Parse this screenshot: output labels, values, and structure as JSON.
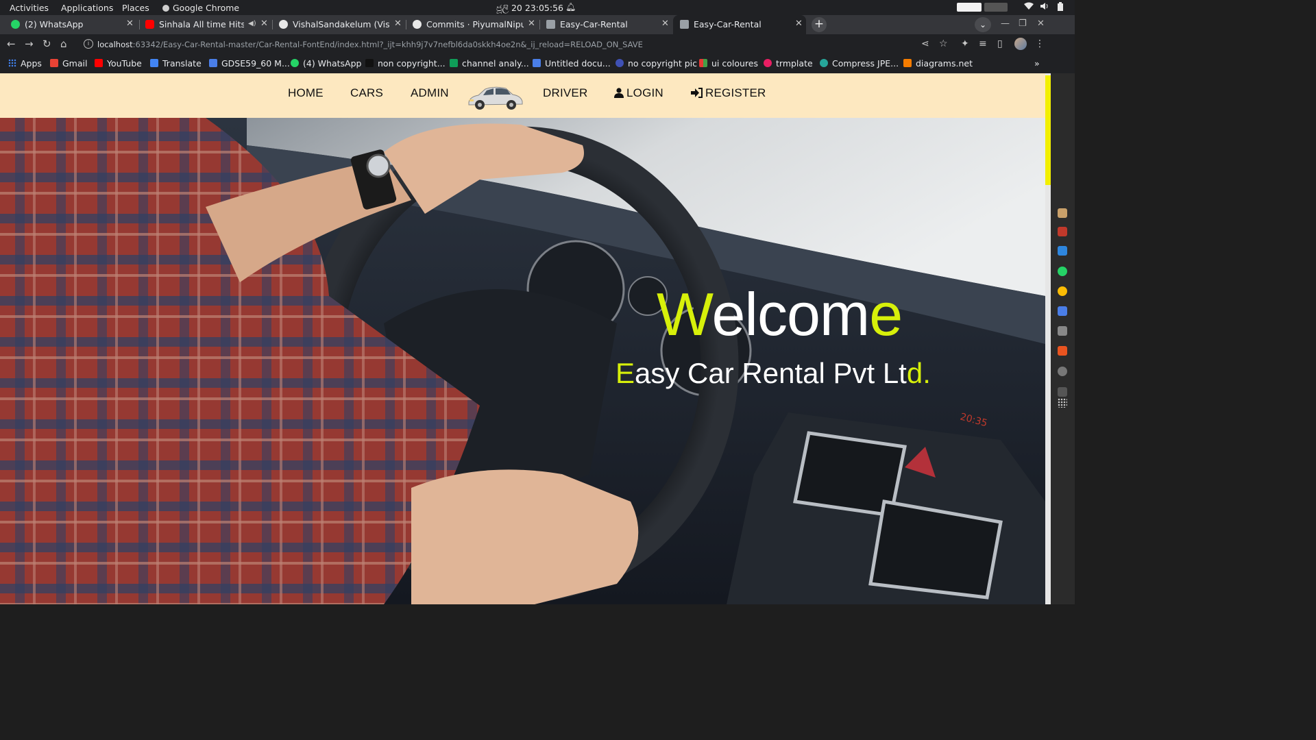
{
  "os_bar": {
    "activities": "Activities",
    "applications": "Applications",
    "places": "Places",
    "active_app": "Google Chrome",
    "datetime": "ජූලි 20  23:05:56"
  },
  "tabs": [
    {
      "title": "(2) WhatsApp",
      "active": false
    },
    {
      "title": "Sinhala All time Hits M",
      "active": false
    },
    {
      "title": "VishalSandakelum (Vishal",
      "active": false
    },
    {
      "title": "Commits · PiyumalNipuna",
      "active": false
    },
    {
      "title": "Easy-Car-Rental",
      "active": false
    },
    {
      "title": "Easy-Car-Rental",
      "active": true
    }
  ],
  "address_bar": {
    "host": "localhost",
    "path": ":63342/Easy-Car-Rental-master/Car-Rental-FontEnd/index.html?_ijt=khh9j7v7nefbl6da0skkh4oe2n&_ij_reload=RELOAD_ON_SAVE"
  },
  "bookmarks": [
    {
      "label": "Apps",
      "color": "#4285f4"
    },
    {
      "label": "Gmail",
      "color": "#ea4335"
    },
    {
      "label": "YouTube",
      "color": "#ff0000"
    },
    {
      "label": "Translate",
      "color": "#4285f4"
    },
    {
      "label": "GDSE59_60 M...",
      "color": "#4a7ee8"
    },
    {
      "label": "(4) WhatsApp",
      "color": "#25d366"
    },
    {
      "label": "non copyright...",
      "color": "#222222"
    },
    {
      "label": "channel analy...",
      "color": "#0f9d58"
    },
    {
      "label": "Untitled docu...",
      "color": "#4a7ee8"
    },
    {
      "label": "no copyright pic",
      "color": "#3f51b5"
    },
    {
      "label": "ui coloures",
      "color": "#e53935"
    },
    {
      "label": "trmplate",
      "color": "#e91e63"
    },
    {
      "label": "Compress JPE...",
      "color": "#26a69a"
    },
    {
      "label": "diagrams.net",
      "color": "#f57c00"
    }
  ],
  "site_nav": {
    "home": "HOME",
    "cars": "CARS",
    "admin": "ADMIN",
    "driver": "DRIVER",
    "login": "LOGIN",
    "register": "REGISTER"
  },
  "hero": {
    "welcome_first": "W",
    "welcome_mid": "elcom",
    "welcome_last": "e",
    "subtitle_first": "E",
    "subtitle_mid": "asy Car Rental Pvt Lt",
    "subtitle_last": "d."
  },
  "colors": {
    "accent": "#d7f00a",
    "navbar_bg": "#fde8c0"
  }
}
